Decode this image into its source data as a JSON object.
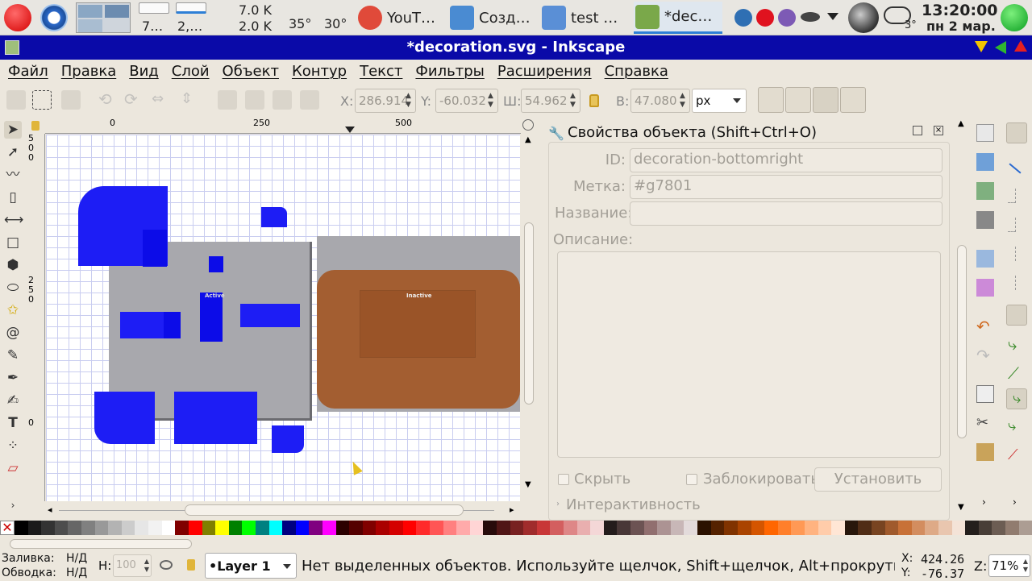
{
  "taskbar": {
    "desktops": [
      "7…",
      "2,…"
    ],
    "net": {
      "up": "7.0 K",
      "down": "2.0 K"
    },
    "temps": [
      "35°",
      "30°"
    ],
    "tasks": [
      {
        "label": "YouT…",
        "icon": "yandex-browser-icon",
        "color": "#e04a3a"
      },
      {
        "label": "Созд…",
        "icon": "text-editor-icon",
        "color": "#4a8bd2"
      },
      {
        "label": "test …",
        "icon": "folder-icon",
        "color": "#5a8fd6"
      },
      {
        "label": "*dec…",
        "icon": "inkscape-icon",
        "color": "#7aa84a"
      }
    ],
    "weather_temp": "3°",
    "time": "13:20:00",
    "date": "пн 2 мар."
  },
  "window": {
    "title": "*decoration.svg - Inkscape"
  },
  "menu": [
    "Файл",
    "Правка",
    "Вид",
    "Слой",
    "Объект",
    "Контур",
    "Текст",
    "Фильтры",
    "Расширения",
    "Справка"
  ],
  "toolbar": {
    "x_label": "X:",
    "x_value": "286.914",
    "y_label": "Y:",
    "y_value": "-60.032",
    "w_label": "Ш:",
    "w_value": "54.962",
    "h_label": "В:",
    "h_value": "47.080",
    "unit": "px"
  },
  "rulers": {
    "h_ticks": [
      "0",
      "250",
      "500"
    ],
    "v_ticks": [
      "5\n0\n0",
      "2\n5\n0",
      "0"
    ]
  },
  "canvas": {
    "active_label": "Active",
    "inactive_label": "Inactive"
  },
  "panel": {
    "title": "Свойства объекта (Shift+Ctrl+O)",
    "id_label": "ID:",
    "id_value": "decoration-bottomright",
    "label_label": "Метка:",
    "label_value": "#g7801",
    "name_label": "Название:",
    "name_value": "",
    "desc_label": "Описание:",
    "hide_label": "Скрыть",
    "lock_label": "Заблокировать",
    "set_button": "Установить",
    "interactivity": "Интерактивность"
  },
  "palette": [
    "#000000",
    "#1a1a1a",
    "#333333",
    "#4d4d4d",
    "#666666",
    "#808080",
    "#999999",
    "#b3b3b3",
    "#cccccc",
    "#e6e6e6",
    "#f2f2f2",
    "#ffffff",
    "#800000",
    "#ff0000",
    "#808000",
    "#ffff00",
    "#008000",
    "#00ff00",
    "#008080",
    "#00ffff",
    "#000080",
    "#0000ff",
    "#800080",
    "#ff00ff",
    "#2b0000",
    "#550000",
    "#800000",
    "#aa0000",
    "#d40000",
    "#ff0000",
    "#ff2a2a",
    "#ff5555",
    "#ff8080",
    "#ffaaaa",
    "#ffd5d5",
    "#280b0b",
    "#501616",
    "#782121",
    "#a02c2c",
    "#c83737",
    "#d35f5f",
    "#de8787",
    "#e9afaf",
    "#f4d7d7",
    "#241c1c",
    "#483737",
    "#6c5353",
    "#916f6f",
    "#ac9393",
    "#c8b7b7",
    "#e3dbdb",
    "#2b1100",
    "#552200",
    "#803300",
    "#aa4400",
    "#d45500",
    "#ff6600",
    "#ff7f2a",
    "#ff9955",
    "#ffb380",
    "#ffccaa",
    "#ffe6d5",
    "#28170b",
    "#502d16",
    "#784421",
    "#a05a2c",
    "#c87137",
    "#d38d5f",
    "#deaa87",
    "#e9c6af",
    "#f4e3d7",
    "#241f1c",
    "#483e37",
    "#6c5d53",
    "#917c6f",
    "#ac9d93"
  ],
  "status": {
    "fill_label": "Заливка:",
    "fill_value": "Н/Д",
    "stroke_label": "Обводка:",
    "stroke_value": "Н/Д",
    "h_label": "Н:",
    "h_value": "100",
    "layer": "•Layer 1",
    "message": "Нет выделенных объектов. Используйте щелчок, Shift+щелчок, Alt+прокрутка колес…",
    "cx_label": "X:",
    "cx": "424.26",
    "cy_label": "Y:",
    "cy": "-76.37",
    "zoom_label": "Z:",
    "zoom": "71%"
  }
}
